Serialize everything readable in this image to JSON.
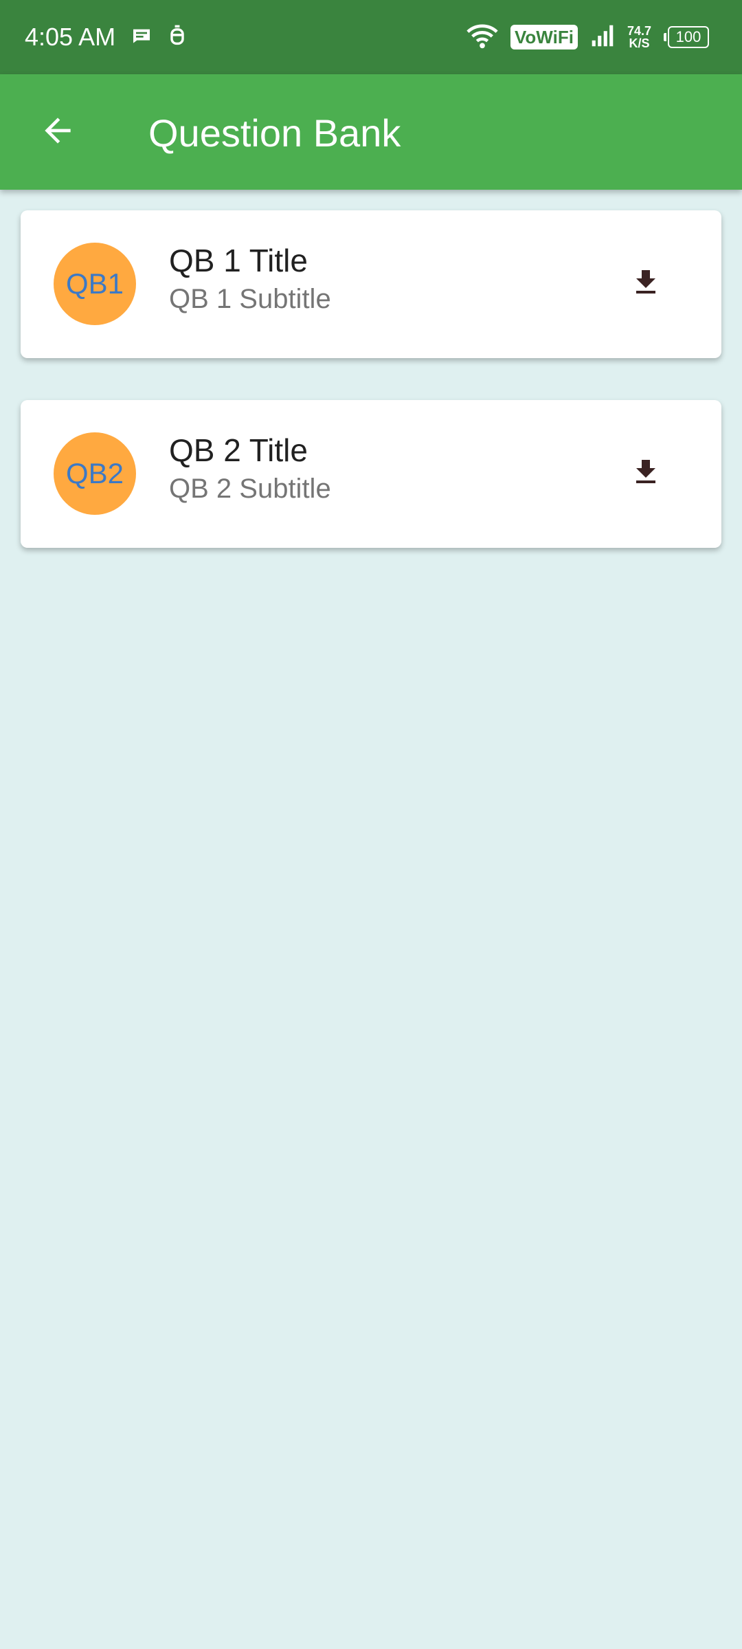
{
  "status_bar": {
    "time": "4:05 AM",
    "vowifi": "VoWiFi",
    "speed_value": "74.7",
    "speed_unit": "K/S",
    "battery": "100"
  },
  "app_bar": {
    "title": "Question Bank"
  },
  "items": [
    {
      "avatar": "QB1",
      "title": "QB 1 Title",
      "subtitle": "QB 1 Subtitle"
    },
    {
      "avatar": "QB2",
      "title": "QB 2 Title",
      "subtitle": "QB 2 Subtitle"
    }
  ],
  "colors": {
    "status_bar": "#3a843e",
    "app_bar": "#4caf50",
    "background": "#dff0f0",
    "avatar_bg": "#ffa940",
    "avatar_text": "#3c79c6",
    "download_icon": "#3a2222"
  }
}
